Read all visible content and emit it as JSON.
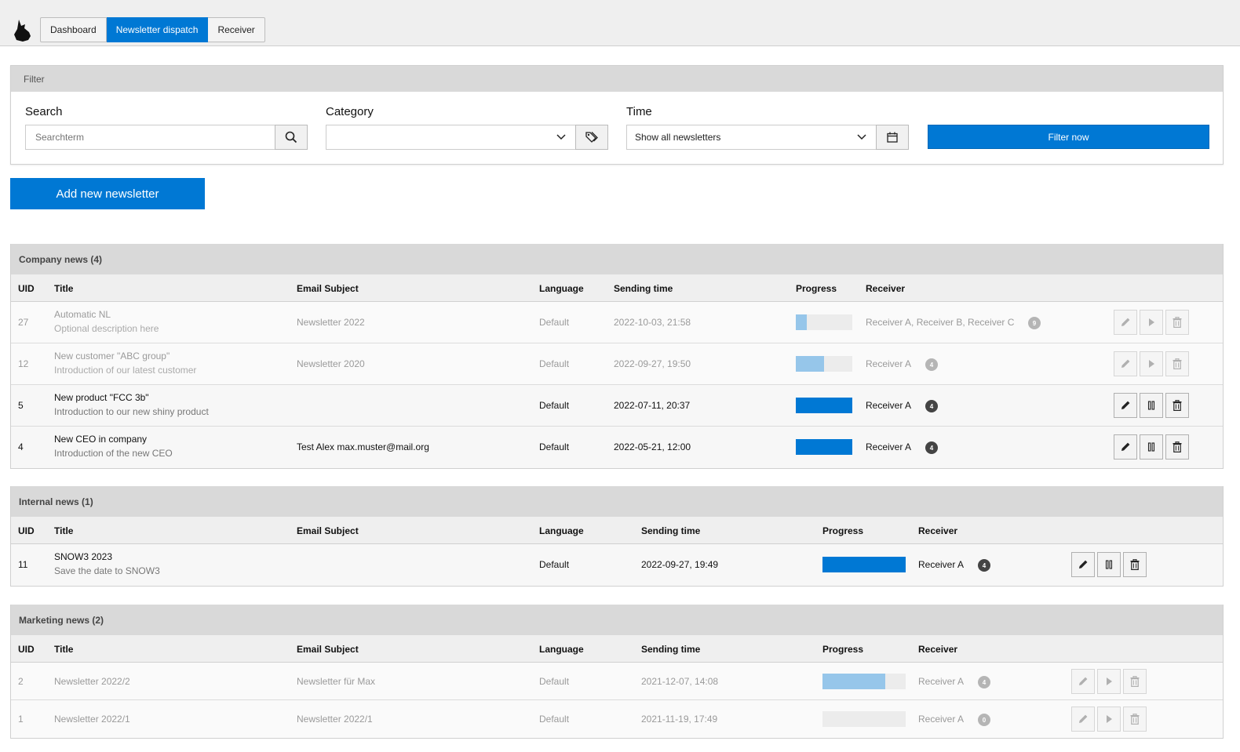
{
  "nav": {
    "tabs": [
      {
        "label": "Dashboard",
        "active": false
      },
      {
        "label": "Newsletter dispatch",
        "active": true
      },
      {
        "label": "Receiver",
        "active": false
      }
    ]
  },
  "filter": {
    "title": "Filter",
    "search": {
      "label": "Search",
      "placeholder": "Searchterm",
      "value": ""
    },
    "category": {
      "label": "Category",
      "value": ""
    },
    "time": {
      "label": "Time",
      "value": "Show all newsletters"
    },
    "submit_label": "Filter now"
  },
  "add_button_label": "Add new newsletter",
  "colors": {
    "accent": "#0078d4",
    "accent_light": "#96c6ea"
  },
  "groups": [
    {
      "title": "Company news (4)",
      "columns": [
        "UID",
        "Title",
        "Email Subject",
        "Language",
        "Sending time",
        "Progress",
        "Receiver"
      ],
      "rows": [
        {
          "uid": "27",
          "title": "Automatic NL",
          "description": "Optional description here",
          "subject": "Newsletter 2022",
          "language": "Default",
          "time": "2022-10-03, 21:58",
          "progress": 0.2,
          "receiver": "Receiver A, Receiver B, Receiver C",
          "count": "9",
          "dim": true,
          "action": "play"
        },
        {
          "uid": "12",
          "title": "New customer \"ABC group\"",
          "description": "Introduction of our latest customer",
          "subject": "Newsletter 2020",
          "language": "Default",
          "time": "2022-09-27, 19:50",
          "progress": 0.5,
          "receiver": "Receiver A",
          "count": "4",
          "dim": true,
          "action": "play"
        },
        {
          "uid": "5",
          "title": "New product \"FCC 3b\"",
          "description": "Introduction to our new shiny product",
          "subject": "",
          "language": "Default",
          "time": "2022-07-11, 20:37",
          "progress": 1.0,
          "receiver": "Receiver A",
          "count": "4",
          "dim": false,
          "action": "pause"
        },
        {
          "uid": "4",
          "title": "New CEO in company",
          "description": "Introduction of the new CEO",
          "subject": "Test Alex max.muster@mail.org",
          "language": "Default",
          "time": "2022-05-21, 12:00",
          "progress": 1.0,
          "receiver": "Receiver A",
          "count": "4",
          "dim": false,
          "action": "pause"
        }
      ]
    },
    {
      "title": "Internal news (1)",
      "columns": [
        "UID",
        "Title",
        "Email Subject",
        "Language",
        "Sending time",
        "Progress",
        "Receiver"
      ],
      "rows": [
        {
          "uid": "11",
          "title": "SNOW3 2023",
          "description": "Save the date to SNOW3",
          "subject": "",
          "language": "Default",
          "time": "2022-09-27, 19:49",
          "progress": 1.0,
          "receiver": "Receiver A",
          "count": "4",
          "dim": false,
          "action": "pause"
        }
      ]
    },
    {
      "title": "Marketing news (2)",
      "columns": [
        "UID",
        "Title",
        "Email Subject",
        "Language",
        "Sending time",
        "Progress",
        "Receiver"
      ],
      "rows": [
        {
          "uid": "2",
          "title": "Newsletter 2022/2",
          "description": "",
          "subject": "Newsletter für Max",
          "language": "Default",
          "time": "2021-12-07, 14:08",
          "progress": 0.75,
          "receiver": "Receiver A",
          "count": "4",
          "dim": true,
          "action": "play"
        },
        {
          "uid": "1",
          "title": "Newsletter 2022/1",
          "description": "",
          "subject": "Newsletter 2022/1",
          "language": "Default",
          "time": "2021-11-19, 17:49",
          "progress": 0.0,
          "receiver": "Receiver A",
          "count": "0",
          "dim": true,
          "action": "play"
        }
      ]
    }
  ]
}
